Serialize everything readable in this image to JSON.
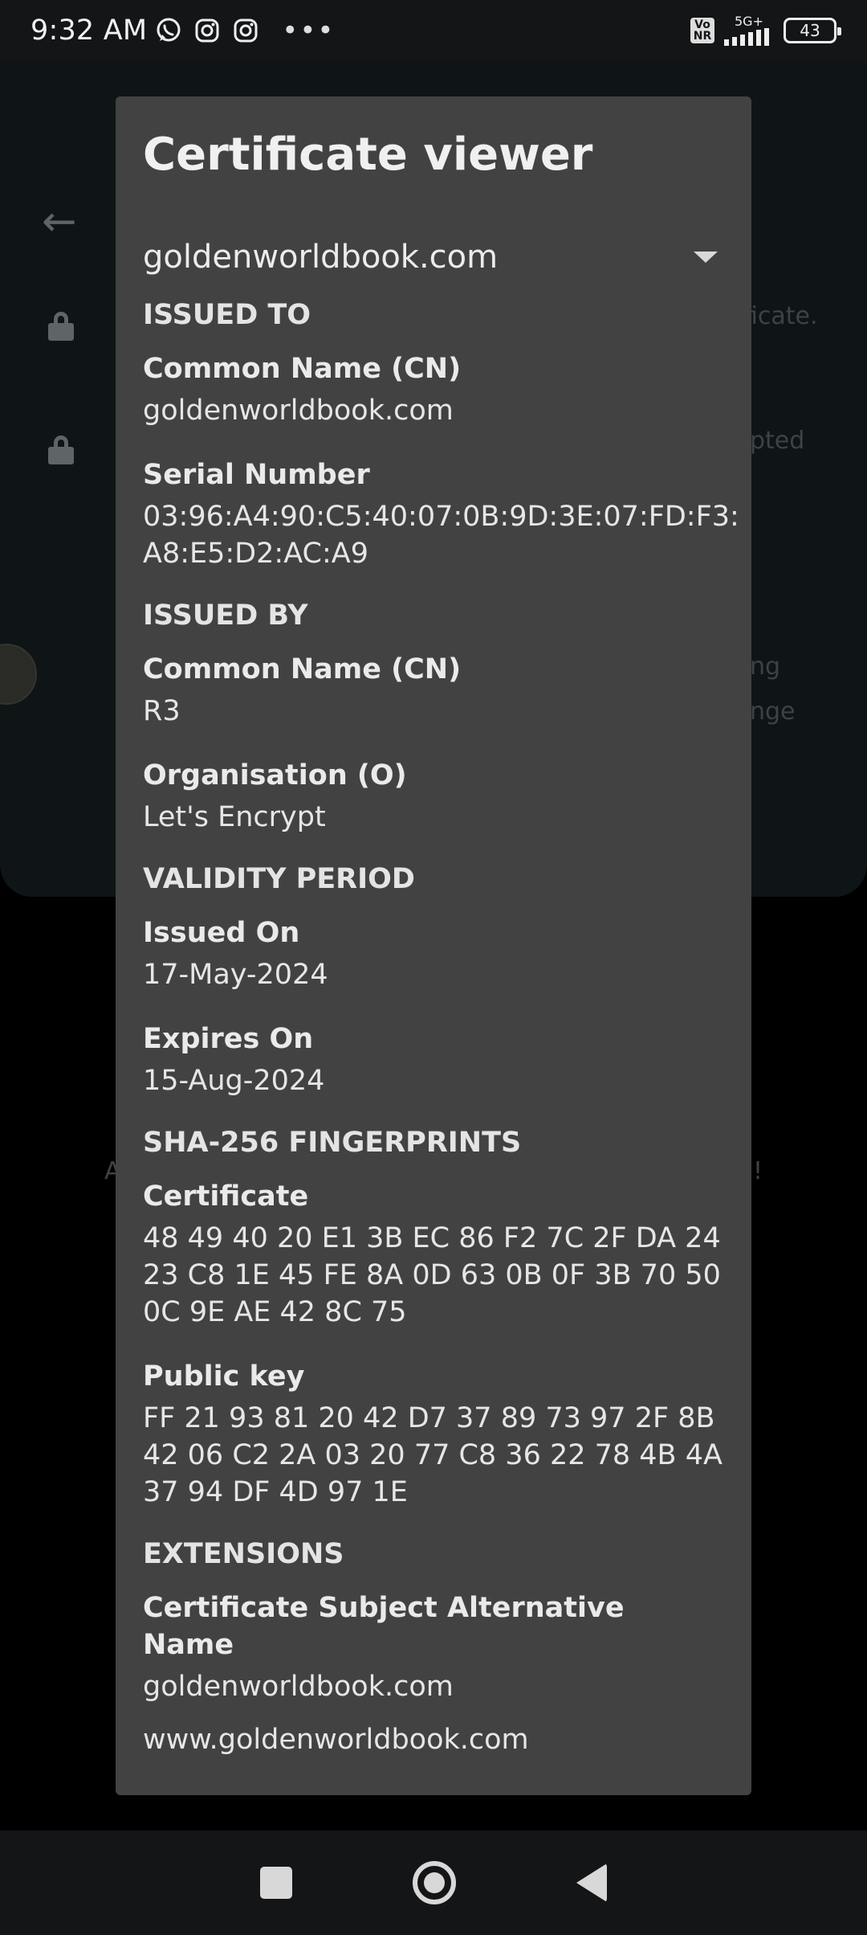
{
  "status_bar": {
    "time": "9:32 AM",
    "volte": "Vo NR",
    "network": "5G+",
    "battery": "43",
    "app_icons": [
      "whatsapp-icon",
      "instagram-icon",
      "instagram-icon"
    ],
    "more": "•••"
  },
  "background": {
    "back_icon": "←",
    "fragments": [
      {
        "text": "ficate."
      },
      {
        "text": "pted"
      },
      {
        "text": "ng"
      },
      {
        "text": "nge"
      },
      {
        "text": "A"
      },
      {
        "text": "!"
      }
    ]
  },
  "dialog": {
    "title": "Certificate viewer",
    "selected_certificate": "goldenworldbook.com",
    "issued_to": {
      "heading": "ISSUED TO",
      "cn_label": "Common Name (CN)",
      "cn_value": "goldenworldbook.com",
      "serial_label": "Serial Number",
      "serial_line1": "03:96:A4:90:C5:40:07:0B:9D:3E:07:FD:F3:",
      "serial_line2": "A8:E5:D2:AC:A9"
    },
    "issued_by": {
      "heading": "ISSUED BY",
      "cn_label": "Common Name (CN)",
      "cn_value": "R3",
      "org_label": "Organisation (O)",
      "org_value": "Let's Encrypt"
    },
    "validity": {
      "heading": "VALIDITY PERIOD",
      "issued_label": "Issued On",
      "issued_value": "17-May-2024",
      "expires_label": "Expires On",
      "expires_value": "15-Aug-2024"
    },
    "fingerprints": {
      "heading": "SHA-256 FINGERPRINTS",
      "cert_label": "Certificate",
      "cert_line1": "48 49 40 20 E1 3B EC 86 F2 7C 2F DA 24",
      "cert_line2": "23 C8 1E 45 FE 8A 0D 63 0B 0F 3B 70 50",
      "cert_line3": "0C 9E AE 42 8C 75",
      "pubkey_label": "Public key",
      "pubkey_line1": "FF 21 93 81 20 42 D7 37 89 73 97 2F 8B",
      "pubkey_line2": "42 06 C2 2A 03 20 77 C8 36 22 78 4B 4A",
      "pubkey_line3": "37 94 DF 4D 97 1E"
    },
    "extensions": {
      "heading": "EXTENSIONS",
      "san_label": "Certificate Subject Alternative Name",
      "san_value1": "goldenworldbook.com",
      "san_value2": "www.goldenworldbook.com"
    }
  }
}
